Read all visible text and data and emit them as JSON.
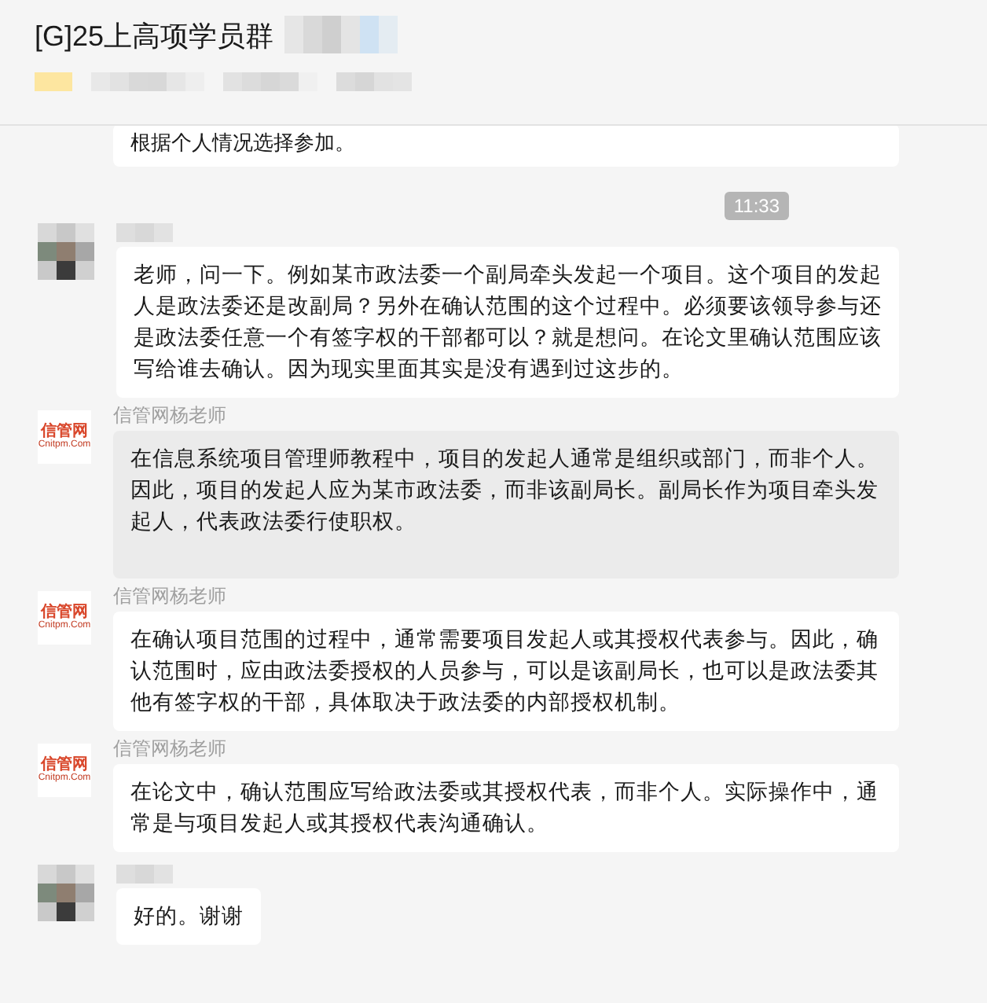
{
  "window": {
    "title": "[G]25上高项学员群"
  },
  "messages": [
    {
      "kind": "partial",
      "text": "根据个人情况选择参加。"
    },
    {
      "kind": "time",
      "text": "11:33"
    },
    {
      "kind": "message",
      "avatar": {
        "kind": "blurred"
      },
      "selected": false,
      "text": "老师，问一下。例如某市政法委一个副局牵头发起一个项目。这个项目的发起人是政法委还是改副局？另外在确认范围的这个过程中。必须要该领导参与还是政法委任意一个有签字权的干部都可以？就是想问。在论文里确认范围应该写给谁去确认。因为现实里面其实是没有遇到过这步的。"
    },
    {
      "kind": "message",
      "avatar": {
        "kind": "logo",
        "title": "信管网",
        "subtitle": "Cnitpm.Com"
      },
      "sender": "信管网杨老师",
      "selected": true,
      "text": "在信息系统项目管理师教程中，项目的发起人通常是组织或部门，而非个人。因此，项目的发起人应为某市政法委，而非该副局长。副局长作为项目牵头发起人，代表政法委行使职权。"
    },
    {
      "kind": "message",
      "avatar": {
        "kind": "logo",
        "title": "信管网",
        "subtitle": "Cnitpm.Com"
      },
      "sender": "信管网杨老师",
      "selected": false,
      "text": "在确认项目范围的过程中，通常需要项目发起人或其授权代表参与。因此，确认范围时，应由政法委授权的人员参与，可以是该副局长，也可以是政法委其他有签字权的干部，具体取决于政法委的内部授权机制。"
    },
    {
      "kind": "message",
      "avatar": {
        "kind": "logo",
        "title": "信管网",
        "subtitle": "Cnitpm.Com"
      },
      "sender": "信管网杨老师",
      "selected": false,
      "text": "在论文中，确认范围应写给政法委或其授权代表，而非个人。实际操作中，通常是与项目发起人或其授权代表沟通确认。"
    },
    {
      "kind": "message",
      "avatar": {
        "kind": "blurred"
      },
      "selected": false,
      "text": "好的。谢谢"
    }
  ]
}
